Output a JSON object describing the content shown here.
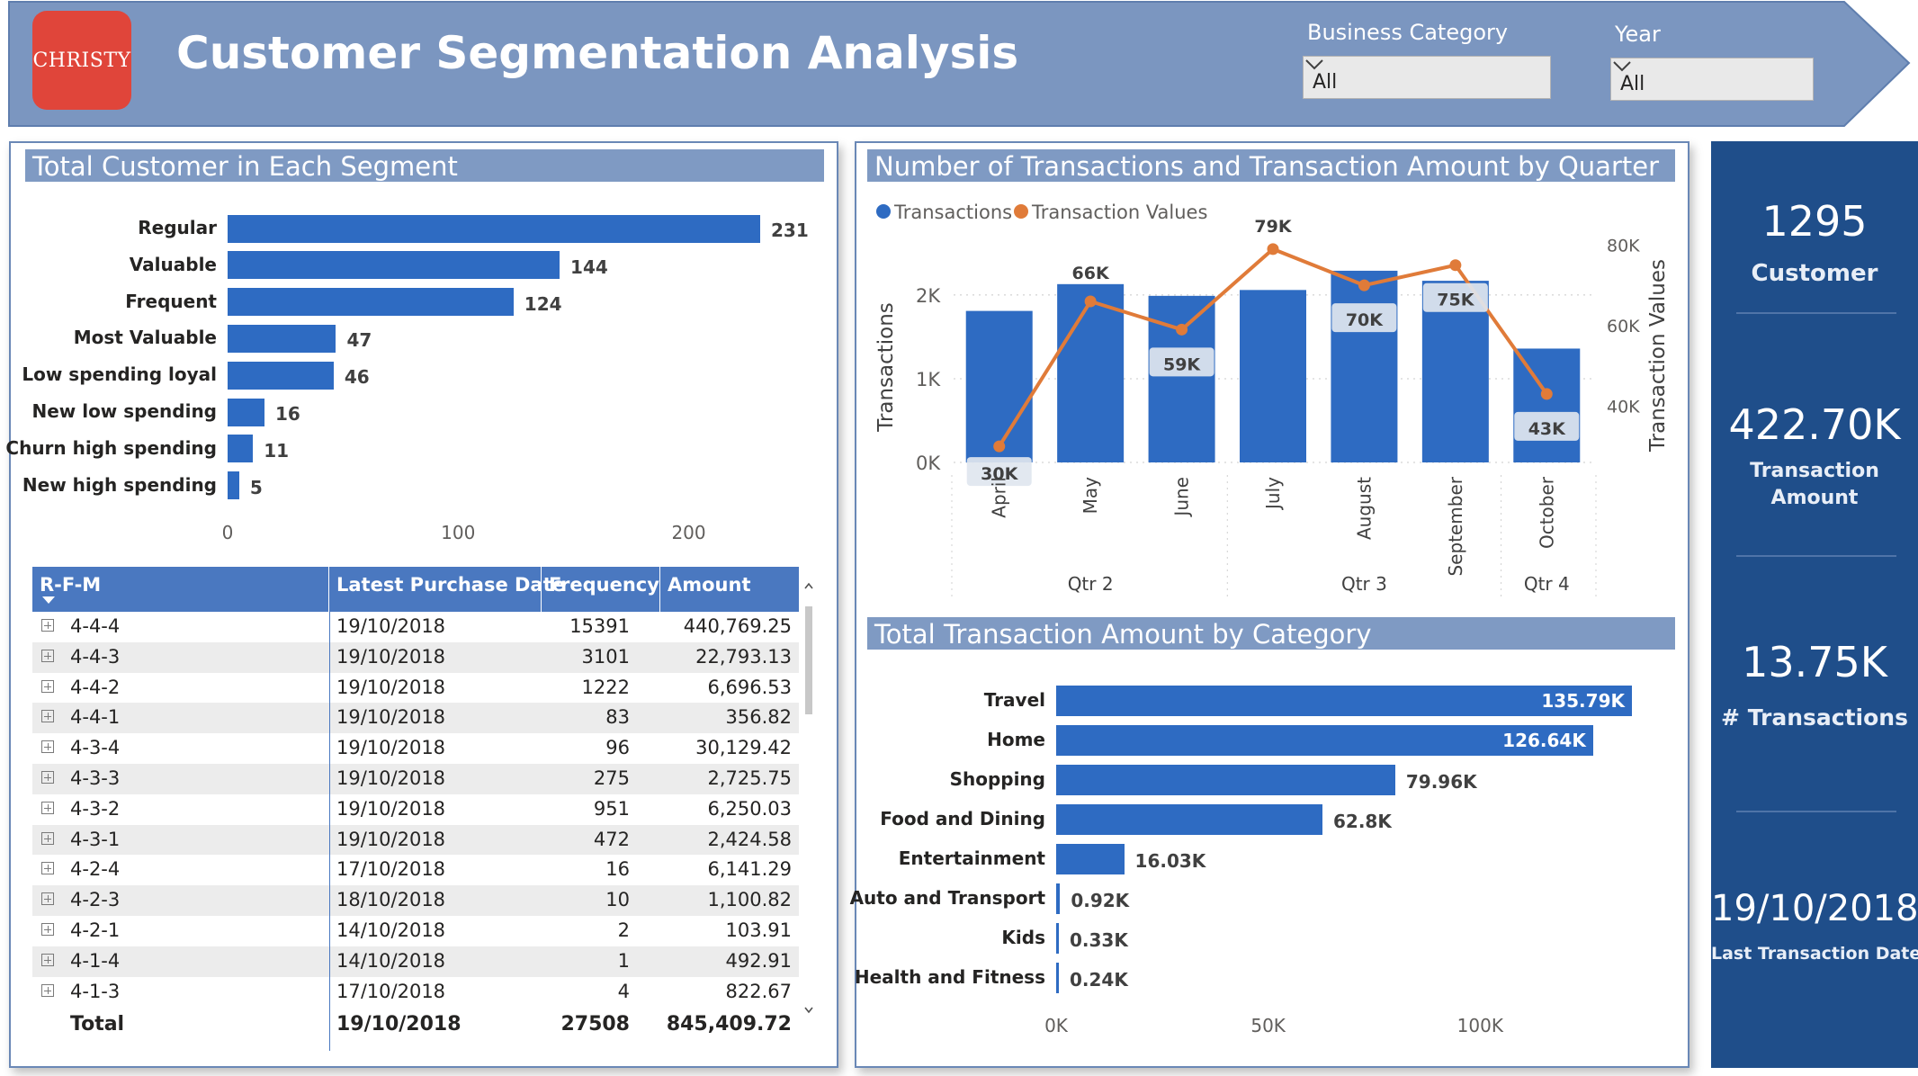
{
  "header": {
    "logo_text": "CHRISTY",
    "title": "Customer Segmentation Analysis",
    "slicers": [
      {
        "label": "Business Category",
        "value": "All"
      },
      {
        "label": "Year",
        "value": "All"
      }
    ]
  },
  "segment_panel": {
    "title": "Total Customer in Each Segment",
    "chart_data": {
      "type": "bar",
      "orientation": "horizontal",
      "categories": [
        "Regular",
        "Valuable",
        "Frequent",
        "Most Valuable",
        "Low spending loyal",
        "New low spending",
        "Churn high spending",
        "New high spending"
      ],
      "values": [
        231,
        144,
        124,
        47,
        46,
        16,
        11,
        5
      ],
      "value_labels": [
        "231",
        "144",
        "124",
        "47",
        "46",
        "16",
        "11",
        "5"
      ],
      "xlim": [
        0,
        231
      ],
      "ticks": [
        {
          "value": 0,
          "label": "0"
        },
        {
          "value": 100,
          "label": "100"
        },
        {
          "value": 200,
          "label": "200"
        }
      ],
      "color": "#2e6bc2"
    }
  },
  "rfm_table": {
    "columns": [
      "R-F-M",
      "Latest Purchase Date",
      "Frequency",
      "Amount"
    ],
    "rows": [
      {
        "rfm": "4-4-4",
        "date": "19/10/2018",
        "frequency": "15391",
        "amount": "440,769.25"
      },
      {
        "rfm": "4-4-3",
        "date": "19/10/2018",
        "frequency": "3101",
        "amount": "22,793.13"
      },
      {
        "rfm": "4-4-2",
        "date": "19/10/2018",
        "frequency": "1222",
        "amount": "6,696.53"
      },
      {
        "rfm": "4-4-1",
        "date": "19/10/2018",
        "frequency": "83",
        "amount": "356.82"
      },
      {
        "rfm": "4-3-4",
        "date": "19/10/2018",
        "frequency": "96",
        "amount": "30,129.42"
      },
      {
        "rfm": "4-3-3",
        "date": "19/10/2018",
        "frequency": "275",
        "amount": "2,725.75"
      },
      {
        "rfm": "4-3-2",
        "date": "19/10/2018",
        "frequency": "951",
        "amount": "6,250.03"
      },
      {
        "rfm": "4-3-1",
        "date": "19/10/2018",
        "frequency": "472",
        "amount": "2,424.58"
      },
      {
        "rfm": "4-2-4",
        "date": "17/10/2018",
        "frequency": "16",
        "amount": "6,141.29"
      },
      {
        "rfm": "4-2-3",
        "date": "18/10/2018",
        "frequency": "10",
        "amount": "1,100.82"
      },
      {
        "rfm": "4-2-1",
        "date": "14/10/2018",
        "frequency": "2",
        "amount": "103.91"
      },
      {
        "rfm": "4-1-4",
        "date": "14/10/2018",
        "frequency": "1",
        "amount": "492.91"
      },
      {
        "rfm": "4-1-3",
        "date": "17/10/2018",
        "frequency": "4",
        "amount": "822.67"
      }
    ],
    "total": {
      "label": "Total",
      "date": "19/10/2018",
      "frequency": "27508",
      "amount": "845,409.72"
    }
  },
  "quarter_panel": {
    "title": "Number of Transactions and Transaction Amount by Quarter",
    "chart_data": {
      "type": "bar+line",
      "categories": [
        "April",
        "May",
        "June",
        "July",
        "August",
        "September",
        "October"
      ],
      "groups": [
        {
          "label": "Qtr 2",
          "span": [
            0,
            2
          ]
        },
        {
          "label": "Qtr 3",
          "span": [
            3,
            5
          ]
        },
        {
          "label": "Qtr 4",
          "span": [
            6,
            6
          ]
        }
      ],
      "series": [
        {
          "name": "Transactions",
          "type": "bar",
          "axis": "left",
          "color": "#2e6bc2",
          "values": [
            1810,
            2130,
            1990,
            2060,
            2290,
            2170,
            1360
          ]
        },
        {
          "name": "Transaction Values",
          "type": "line",
          "axis": "right",
          "color": "#e07b39",
          "values": [
            30000,
            66000,
            59000,
            79000,
            70000,
            75000,
            43000
          ],
          "data_labels": [
            "30K",
            "66K",
            "59K",
            "79K",
            "70K",
            "75K",
            "43K"
          ]
        }
      ],
      "left_axis": {
        "label": "Transactions",
        "ylim": [
          0,
          2300
        ],
        "ticks": [
          {
            "value": 0,
            "label": "0K"
          },
          {
            "value": 1000,
            "label": "1K"
          },
          {
            "value": 2000,
            "label": "2K"
          }
        ]
      },
      "right_axis": {
        "label": "Transaction Values",
        "ylim": [
          26000,
          85000
        ],
        "ticks": [
          {
            "value": 40000,
            "label": "40K"
          },
          {
            "value": 60000,
            "label": "60K"
          },
          {
            "value": 80000,
            "label": "80K"
          }
        ]
      },
      "legend": [
        "Transactions",
        "Transaction Values"
      ],
      "legend_position": "top-left",
      "grid": true
    }
  },
  "category_panel": {
    "title": "Total Transaction Amount by Category",
    "chart_data": {
      "type": "bar",
      "orientation": "horizontal",
      "categories": [
        "Travel",
        "Home",
        "Shopping",
        "Food and Dining",
        "Entertainment",
        "Auto and Transport",
        "Kids",
        "Health and Fitness"
      ],
      "values": [
        135790,
        126640,
        79960,
        62800,
        16030,
        920,
        330,
        240
      ],
      "value_labels": [
        "135.79K",
        "126.64K",
        "79.96K",
        "62.8K",
        "16.03K",
        "0.92K",
        "0.33K",
        "0.24K"
      ],
      "labels_inside": [
        true,
        true,
        false,
        false,
        false,
        false,
        false,
        false
      ],
      "xlim": [
        0,
        135790
      ],
      "ticks": [
        {
          "value": 0,
          "label": "0K"
        },
        {
          "value": 50000,
          "label": "50K"
        },
        {
          "value": 100000,
          "label": "100K"
        }
      ],
      "color": "#2e6bc2"
    }
  },
  "kpis": [
    {
      "value": "1295",
      "label": "Customer"
    },
    {
      "value": "422.70K",
      "label_lines": [
        "Transaction",
        "Amount"
      ]
    },
    {
      "value": "13.75K",
      "label": "# Transactions"
    },
    {
      "value": "19/10/2018",
      "label": "Last Transaction Date"
    }
  ],
  "colors": {
    "header_bg": "#7b96c0",
    "panel_title_bg": "#7f9ac3",
    "bar": "#2e6bc2",
    "line": "#e07b39",
    "kpi_bg": "#1f4e8a",
    "table_header_bg": "#4a78c0"
  }
}
